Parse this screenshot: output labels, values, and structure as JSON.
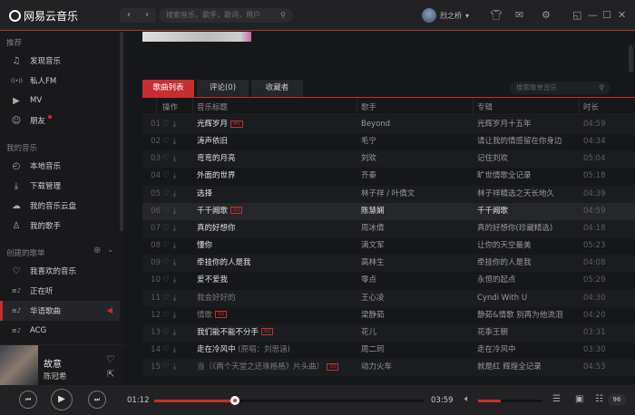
{
  "app": {
    "name": "网易云音乐"
  },
  "header": {
    "back": "‹",
    "forward": "›",
    "search_placeholder": "搜索音乐，歌手，歌词，用户",
    "username": "烈之桥"
  },
  "sidebar": {
    "sections": [
      {
        "title": "推荐",
        "items": [
          {
            "label": "发现音乐",
            "icon": "♫"
          },
          {
            "label": "私人FM",
            "icon": "((•))"
          },
          {
            "label": "MV",
            "icon": "▶"
          },
          {
            "label": "朋友",
            "icon": "☺"
          }
        ]
      },
      {
        "title": "我的音乐",
        "items": [
          {
            "label": "本地音乐",
            "icon": "◴"
          },
          {
            "label": "下载管理",
            "icon": "⤓"
          },
          {
            "label": "我的音乐云盘",
            "icon": "☁"
          },
          {
            "label": "我的歌手",
            "icon": "♙"
          }
        ]
      },
      {
        "title": "创建的歌单",
        "items": [
          {
            "label": "我喜欢的音乐",
            "icon": "♡"
          },
          {
            "label": "正在听",
            "icon": "≡♪"
          },
          {
            "label": "华语歌曲",
            "icon": "≡♪"
          },
          {
            "label": "ACG",
            "icon": "≡♪"
          }
        ]
      }
    ]
  },
  "now_playing": {
    "title": "故意",
    "artist": "陈冠希"
  },
  "tabs": [
    {
      "label": "歌曲列表"
    },
    {
      "label": "评论(0)"
    },
    {
      "label": "收藏者"
    }
  ],
  "playlist_search_placeholder": "搜索歌单音乐",
  "table": {
    "headers": [
      "操作",
      "音乐标题",
      "歌手",
      "专辑",
      "时长"
    ],
    "rows": [
      {
        "num": "01",
        "title": "光辉岁月",
        "badge": "MV",
        "singer": "Beyond",
        "album": "光辉岁月十五年",
        "duration": "04:59"
      },
      {
        "num": "02",
        "title": "涛声依旧",
        "singer": "毛宁",
        "album": "请让我的情感留在你身边",
        "duration": "04:34"
      },
      {
        "num": "03",
        "title": "弯弯的月亮",
        "singer": "刘欢",
        "album": "记住刘欢",
        "duration": "05:04"
      },
      {
        "num": "04",
        "title": "外面的世界",
        "singer": "齐秦",
        "album": "旷世情歌全记录",
        "duration": "05:18"
      },
      {
        "num": "05",
        "title": "选择",
        "singer": "林子祥 / 叶倩文",
        "album": "林子祥精选之天长地久",
        "duration": "04:39"
      },
      {
        "num": "06",
        "title": "千千阙歌",
        "badge": "SQ",
        "singer": "陈慧娴",
        "album": "千千阙歌",
        "duration": "04:59"
      },
      {
        "num": "07",
        "title": "真的好想你",
        "singer": "周冰倩",
        "album": "真的好想你(珍藏精选)",
        "duration": "04:18"
      },
      {
        "num": "08",
        "title": "懂你",
        "singer": "满文军",
        "album": "让你的天空最美",
        "duration": "05:23"
      },
      {
        "num": "09",
        "title": "牵挂你的人是我",
        "singer": "高林生",
        "album": "牵挂你的人是我",
        "duration": "04:08"
      },
      {
        "num": "10",
        "title": "爱不爱我",
        "singer": "零点",
        "album": "永恒的起点",
        "duration": "05:29"
      },
      {
        "num": "11",
        "title": "我会好好的",
        "singer": "王心凌",
        "album": "Cyndi With U",
        "duration": "04:30",
        "dim": true
      },
      {
        "num": "12",
        "title": "情歌",
        "badge": "SQ",
        "singer": "梁静茹",
        "album": "静茹&情歌 别再为他流泪",
        "duration": "04:20",
        "dim": true
      },
      {
        "num": "13",
        "title": "我们能不能不分手",
        "badge": "SQ",
        "singer": "花儿",
        "album": "花季王朝",
        "duration": "03:31"
      },
      {
        "num": "14",
        "title": "走在冷风中",
        "subtitle": "(原唱：刘思涵)",
        "singer": "周二珂",
        "album": "走在冷风中",
        "duration": "03:30"
      },
      {
        "num": "15",
        "title": "当（《两个天堂之还珠格格》片头曲）",
        "badge": "SQ",
        "singer": "动力火车",
        "album": "就是红 辉煌全记录",
        "duration": "04:53",
        "dim": true
      }
    ]
  },
  "player": {
    "elapsed": "01:12",
    "total": "03:59",
    "progress": 0.3,
    "volume": 0.35,
    "playlist_count": "96"
  }
}
